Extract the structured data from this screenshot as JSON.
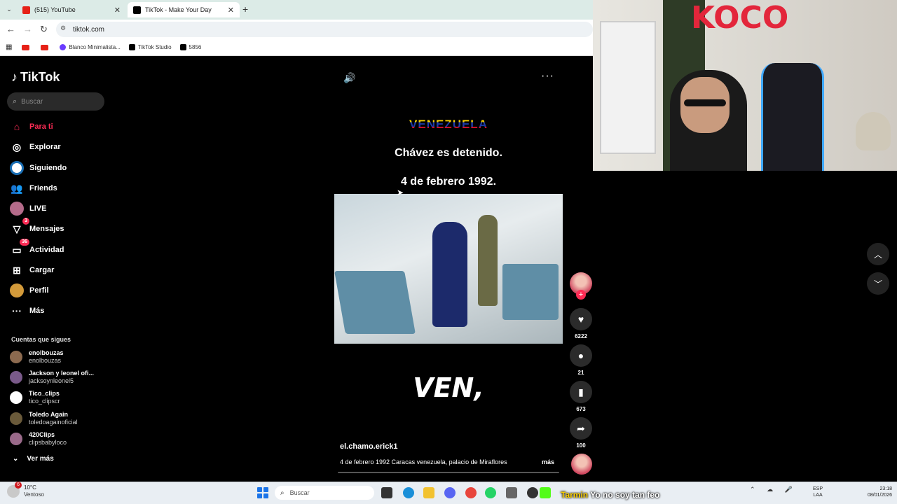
{
  "browser": {
    "tabs": [
      {
        "label": "(515) YouTube",
        "color": "#e62117"
      },
      {
        "label": "TikTok - Make Your Day",
        "color": "#000000"
      }
    ],
    "new_tab": "+",
    "url": "tiktok.com",
    "bookmarks": [
      {
        "label": "",
        "color": "#e62117"
      },
      {
        "label": "",
        "color": "#e62117"
      },
      {
        "label": "Blanco Minimalista...",
        "color": "#6a3cff"
      },
      {
        "label": "TikTok Studio",
        "color": "#000000"
      },
      {
        "label": "5856",
        "color": "#000000"
      }
    ]
  },
  "tiktok": {
    "logo": "TikTok",
    "search_placeholder": "Buscar",
    "nav": [
      {
        "label": "Para ti",
        "icon": "home-icon",
        "active": true
      },
      {
        "label": "Explorar",
        "icon": "compass-icon"
      },
      {
        "label": "Siguiendo",
        "icon": "following-icon"
      },
      {
        "label": "Friends",
        "icon": "friends-icon"
      },
      {
        "label": "LIVE",
        "icon": "live-icon"
      },
      {
        "label": "Mensajes",
        "icon": "messages-icon",
        "badge": "3"
      },
      {
        "label": "Actividad",
        "icon": "activity-icon",
        "badge": "36"
      },
      {
        "label": "Cargar",
        "icon": "upload-icon"
      },
      {
        "label": "Perfil",
        "icon": "profile-icon"
      },
      {
        "label": "Más",
        "icon": "more-icon"
      }
    ],
    "following_title": "Cuentas que sigues",
    "accounts": [
      {
        "name": "enolbouzas",
        "handle": "enolbouzas",
        "color": "#8c6a4f"
      },
      {
        "name": "Jackson y leonel ofi...",
        "handle": "jacksoynleonel5",
        "color": "#7a5a8a"
      },
      {
        "name": "Tico_clips",
        "handle": "tico_clipscr",
        "color": "#ffffff"
      },
      {
        "name": "Toledo Again",
        "handle": "toledoagainoficial",
        "color": "#6a5a3a"
      },
      {
        "name": "420Clips",
        "handle": "clipsbabyloco",
        "color": "#9a6a8a"
      }
    ],
    "see_more": "Ver más",
    "video": {
      "title_overlay": "VENEZUELA",
      "caption_1": "Chávez es detenido.",
      "caption_2": "4 de febrero 1992.",
      "subtitle": "VEN,",
      "author": "el.chamo.erick1",
      "description": "4 de febrero 1992 Caracas venezuela, palacio de Miraflores",
      "more": "más",
      "likes": "6222",
      "comments": "21",
      "saves": "673",
      "shares": "100"
    }
  },
  "taskbar": {
    "weather_badge": "6",
    "temp": "10°C",
    "weather_desc": "Ventoso",
    "search_placeholder": "Buscar",
    "caption_name": "Tarmin",
    "caption_text": "Yo no soy tan feo",
    "lang_1": "ESP",
    "lang_2": "LAA",
    "time": "23:18",
    "date": "08/01/2026"
  }
}
